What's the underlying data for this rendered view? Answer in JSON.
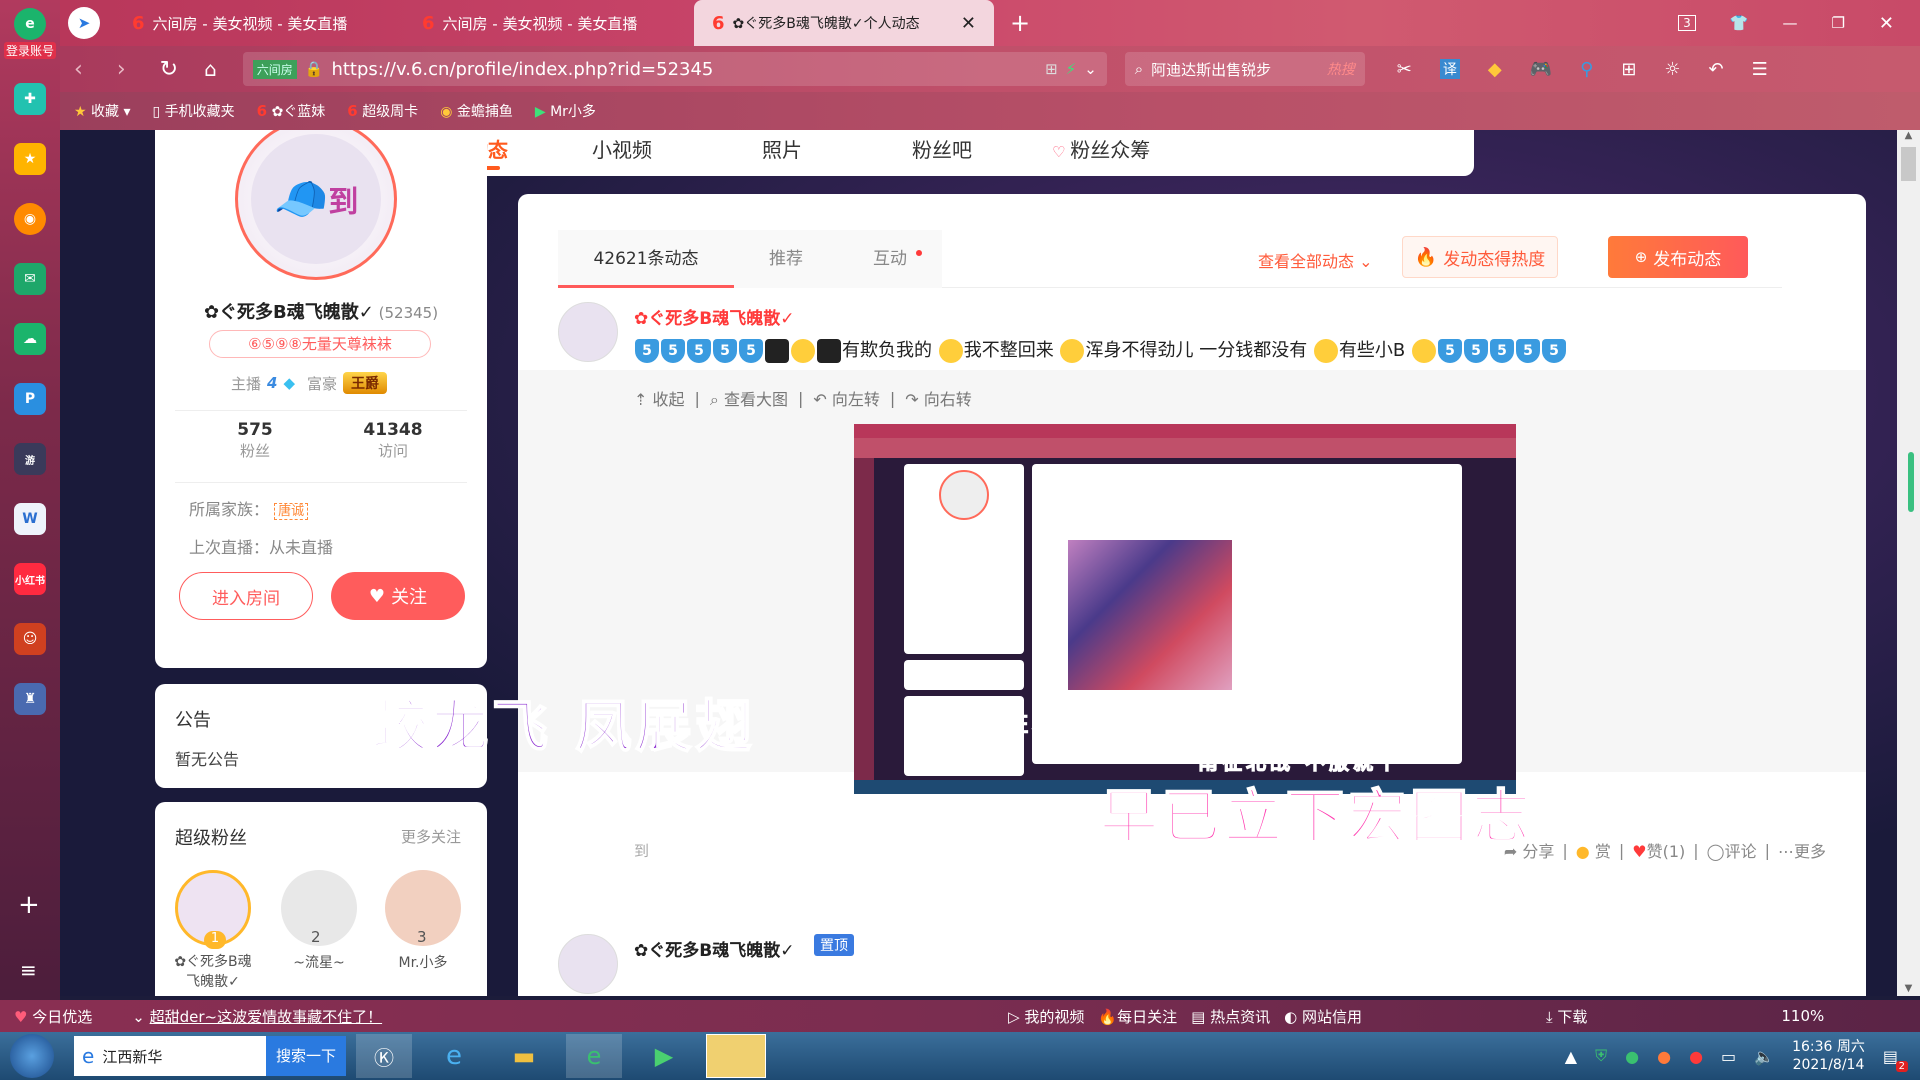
{
  "browser": {
    "login_label": "登录账号",
    "tabs": [
      {
        "label": "六间房 - 美女视频 - 美女直播"
      },
      {
        "label": "六间房 - 美女视频 - 美女直播"
      },
      {
        "label": "✿ぐ死多B魂飞魄散✓个人动态",
        "active": true
      }
    ],
    "tab_count": "3",
    "url": "https://v.6.cn/profile/index.php?rid=52345",
    "site_badge": "六间房",
    "search_text": "阿迪达斯出售锐步",
    "search_hot": "热搜",
    "translate": "译",
    "bookmarks": [
      "收藏",
      "手机收藏夹",
      "✿ぐ蓝妹",
      "超级周卡",
      "金蟾捕鱼",
      "Mr小多"
    ]
  },
  "profile_nav": {
    "items": [
      "动态",
      "小视频",
      "照片",
      "粉丝吧",
      "粉丝众筹"
    ],
    "active": "动态"
  },
  "profile": {
    "name": "✿ぐ死多B魂飞魄散✓",
    "rid": "(52345)",
    "badge_text": "⑥⑤⑨⑧无量天尊袜袜",
    "anchor_label": "主播",
    "anchor_level": "4",
    "rich_label": "富豪",
    "rich_title": "王爵",
    "fans_count": "575",
    "fans_label": "粉丝",
    "visits_count": "41348",
    "visits_label": "访问",
    "family_label": "所属家族：",
    "family_name": "唐诚",
    "last_live": "上次直播：从未直播",
    "enter_room": "进入房间",
    "follow": "关注",
    "avatar_text": "到"
  },
  "notice": {
    "title": "公告",
    "content": "暂无公告"
  },
  "super_fans": {
    "title": "超级粉丝",
    "more": "更多关注",
    "fans": [
      {
        "rank": "1",
        "name": "✿ぐ死多B魂飞魄散✓"
      },
      {
        "rank": "2",
        "name": "~流星~"
      },
      {
        "rank": "3",
        "name": "Mr.小多"
      }
    ]
  },
  "feed": {
    "tabs": [
      "42621条动态",
      "推荐",
      "互动"
    ],
    "view_all": "查看全部动态",
    "hot_button": "发动态得热度",
    "publish_button": "发布动态",
    "post1": {
      "author": "✿ぐ死多B魂飞魄散✓",
      "text_parts": [
        "有欺负我的",
        "我不整回来",
        "浑身不得劲儿 一分钱都没有",
        "有些小B"
      ],
      "emoji_label": "5",
      "actions": [
        "收起",
        "查看大图",
        "向左转",
        "向右转"
      ],
      "footer": [
        "分享",
        "赏",
        "赞(1)",
        "评论",
        "更多"
      ],
      "source_prefix": "到"
    },
    "post2": {
      "author": "✿ぐ死多B魂飞魄散✓",
      "pin": "置顶"
    }
  },
  "overlay_texts": [
    "蛟龙飞  凤展翅",
    "早已立下宏图志",
    "南征北战  不服就干"
  ],
  "statusbar": {
    "pick": "今日优选",
    "news": "超甜der~这波爱情故事藏不住了！",
    "items": [
      "我的视频",
      "每日关注",
      "热点资讯",
      "网站信用"
    ],
    "download": "下载",
    "zoom": "110%"
  },
  "taskbar": {
    "search_text": "江西新华",
    "search_button": "搜索一下",
    "time": "16:36 周六",
    "date": "2021/8/14",
    "notify_count": "2"
  }
}
